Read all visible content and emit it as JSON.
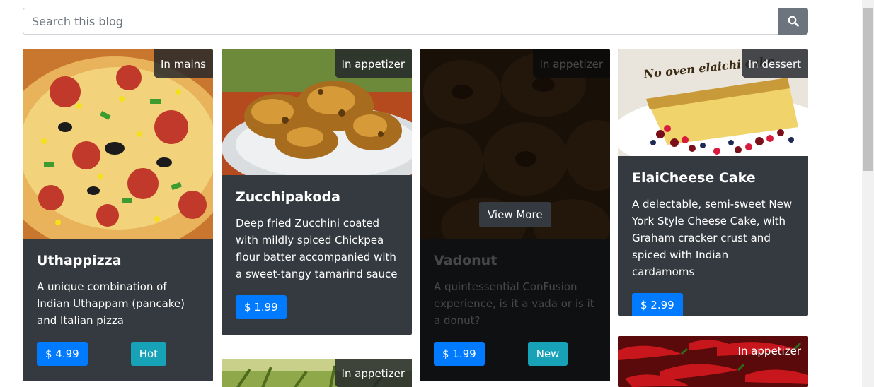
{
  "search": {
    "placeholder": "Search this blog",
    "button_icon": "search-icon"
  },
  "cards": [
    {
      "category": "In mains",
      "title": "Uthappizza",
      "description": "A unique combination of Indian Uthappam (pancake) and Italian pizza",
      "price": "$ 4.99",
      "label": "Hot"
    },
    {
      "category": "In appetizer",
      "title": "Zucchipakoda",
      "description": "Deep fried Zucchini coated with mildly spiced Chickpea flour batter accompanied with a sweet-tangy tamarind sauce",
      "price": "$ 1.99"
    },
    {
      "category": "In appetizer",
      "title": "Vadonut",
      "description": "A quintessential ConFusion experience, is it a vada or is it a donut?",
      "price": "$ 1.99",
      "label": "New",
      "view_more": "View More"
    },
    {
      "category": "In dessert",
      "title": "ElaiCheese Cake",
      "description": "A delectable, semi-sweet New York Style Cheese Cake, with Graham cracker crust and spiced with Indian cardamoms",
      "price": "$ 2.99",
      "image_caption": "No oven elaichi cake"
    },
    {
      "category": "In appetizer"
    },
    {
      "category": "In appetizer"
    }
  ],
  "colors": {
    "card_bg": "#343a40",
    "price": "#007bff",
    "label": "#17a2b8",
    "search_btn": "#6c757d"
  }
}
